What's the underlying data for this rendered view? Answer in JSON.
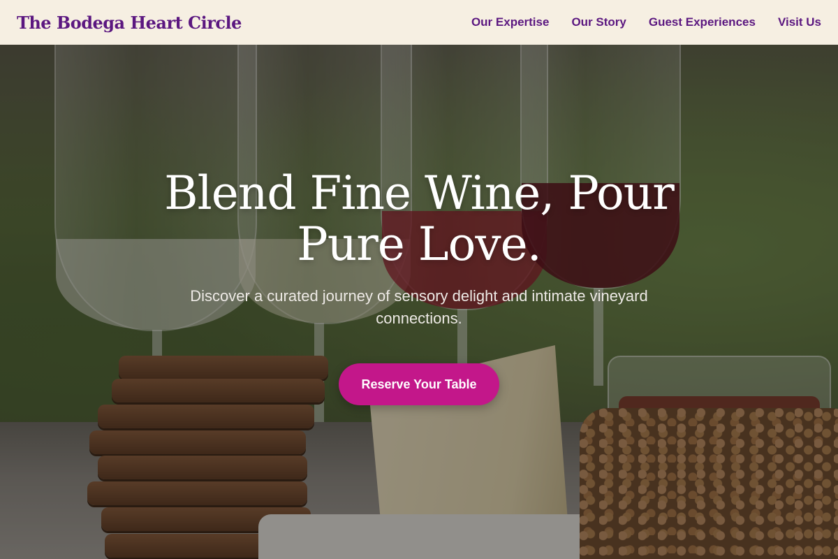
{
  "header": {
    "logo": "The Bodega Heart Circle",
    "nav": [
      {
        "label": "Our Expertise"
      },
      {
        "label": "Our Story"
      },
      {
        "label": "Guest Experiences"
      },
      {
        "label": "Visit Us"
      }
    ]
  },
  "hero": {
    "title": "Blend Fine Wine, Pour Pure Love.",
    "subtitle": "Discover a curated journey of sensory delight and intimate vineyard connections.",
    "cta_label": "Reserve Your Table",
    "background_image": "wine-tasting-flight-with-crackers-and-cheese"
  },
  "colors": {
    "header_bg": "#f6efe2",
    "brand_purple": "#5b1780",
    "cta_magenta": "#c3178a",
    "hero_text": "#ffffff"
  }
}
